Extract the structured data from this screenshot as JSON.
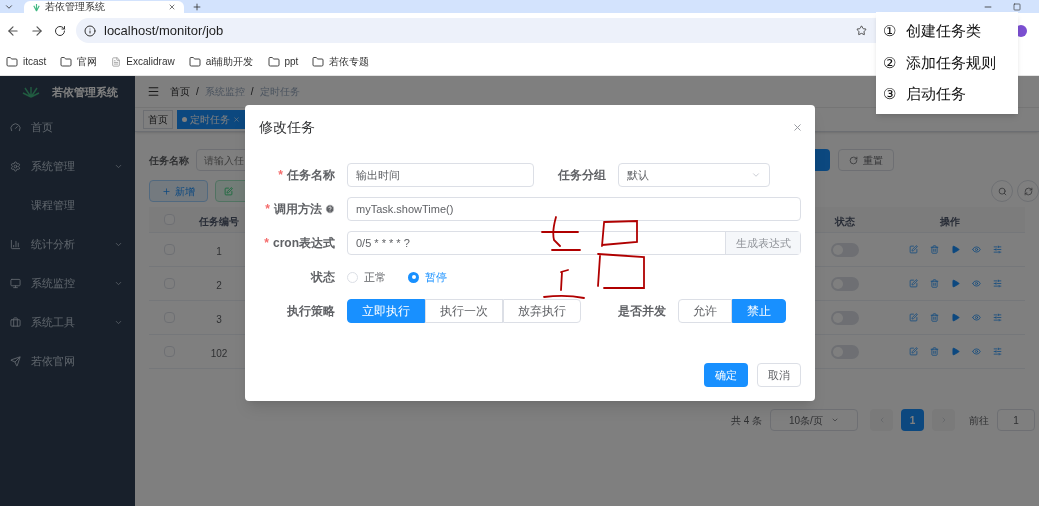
{
  "browser": {
    "tab_title": "若依管理系统",
    "url": "localhost/monitor/job",
    "bookmarks": [
      {
        "label": "itcast",
        "kind": "folder"
      },
      {
        "label": "官网",
        "kind": "folder"
      },
      {
        "label": "Excalidraw",
        "kind": "page"
      },
      {
        "label": "ai辅助开发",
        "kind": "folder"
      },
      {
        "label": "ppt",
        "kind": "folder"
      },
      {
        "label": "若依专题",
        "kind": "folder"
      }
    ]
  },
  "sidebar": {
    "title": "若依管理系统",
    "items": [
      {
        "label": "首页",
        "expandable": false
      },
      {
        "label": "系统管理",
        "expandable": true
      },
      {
        "label": "课程管理",
        "expandable": false
      },
      {
        "label": "统计分析",
        "expandable": true
      },
      {
        "label": "系统监控",
        "expandable": true
      },
      {
        "label": "系统工具",
        "expandable": true
      },
      {
        "label": "若依官网",
        "expandable": false
      }
    ]
  },
  "breadcrumb": {
    "separator": "/",
    "items": [
      "首页",
      "系统监控",
      "定时任务"
    ]
  },
  "tags": [
    {
      "label": "首页",
      "selected": false
    },
    {
      "label": "定时任务",
      "selected": true
    }
  ],
  "search": {
    "label": "任务名称",
    "placeholder": "请输入任",
    "reset": "重置"
  },
  "toolbar": {
    "add": "新增"
  },
  "table": {
    "columns": [
      "任务编号",
      "状态",
      "操作"
    ],
    "all_checked": false,
    "rows": [
      {
        "id": "1",
        "checked": false,
        "on": false
      },
      {
        "id": "2",
        "checked": false,
        "on": false
      },
      {
        "id": "3",
        "checked": false,
        "on": false
      },
      {
        "id": "102",
        "checked": false,
        "on": false
      }
    ]
  },
  "pagination": {
    "total": "共 4 条",
    "page_size": "10条/页",
    "pages": [
      {
        "label": "1",
        "selected": true
      }
    ],
    "goto_label": "前往",
    "goto_value": "1"
  },
  "dialog": {
    "title": "修改任务",
    "required_mark": "*",
    "task_name": {
      "label": "任务名称",
      "required": true,
      "value": "输出时间"
    },
    "task_group": {
      "label": "任务分组",
      "value": "默认"
    },
    "invoke": {
      "label": "调用方法",
      "required": true,
      "value": "myTask.showTime()"
    },
    "cron": {
      "label": "cron表达式",
      "required": true,
      "value": "0/5 * * * * ?",
      "button": "生成表达式"
    },
    "status": {
      "label": "状态",
      "options": [
        {
          "label": "正常",
          "selected": false
        },
        {
          "label": "暂停",
          "selected": true
        }
      ]
    },
    "policy": {
      "label": "执行策略",
      "options": [
        {
          "label": "立即执行",
          "selected": true
        },
        {
          "label": "执行一次",
          "selected": false
        },
        {
          "label": "放弃执行",
          "selected": false
        }
      ]
    },
    "concurrent": {
      "label": "是否并发",
      "options": [
        {
          "label": "允许",
          "selected": false
        },
        {
          "label": "禁止",
          "selected": true
        }
      ]
    },
    "ok": "确定",
    "cancel": "取消"
  },
  "note": {
    "items": [
      {
        "marker": "①",
        "text": "创建任务类"
      },
      {
        "marker": "②",
        "text": "添加任务规则"
      },
      {
        "marker": "③",
        "text": "启动任务"
      }
    ]
  }
}
